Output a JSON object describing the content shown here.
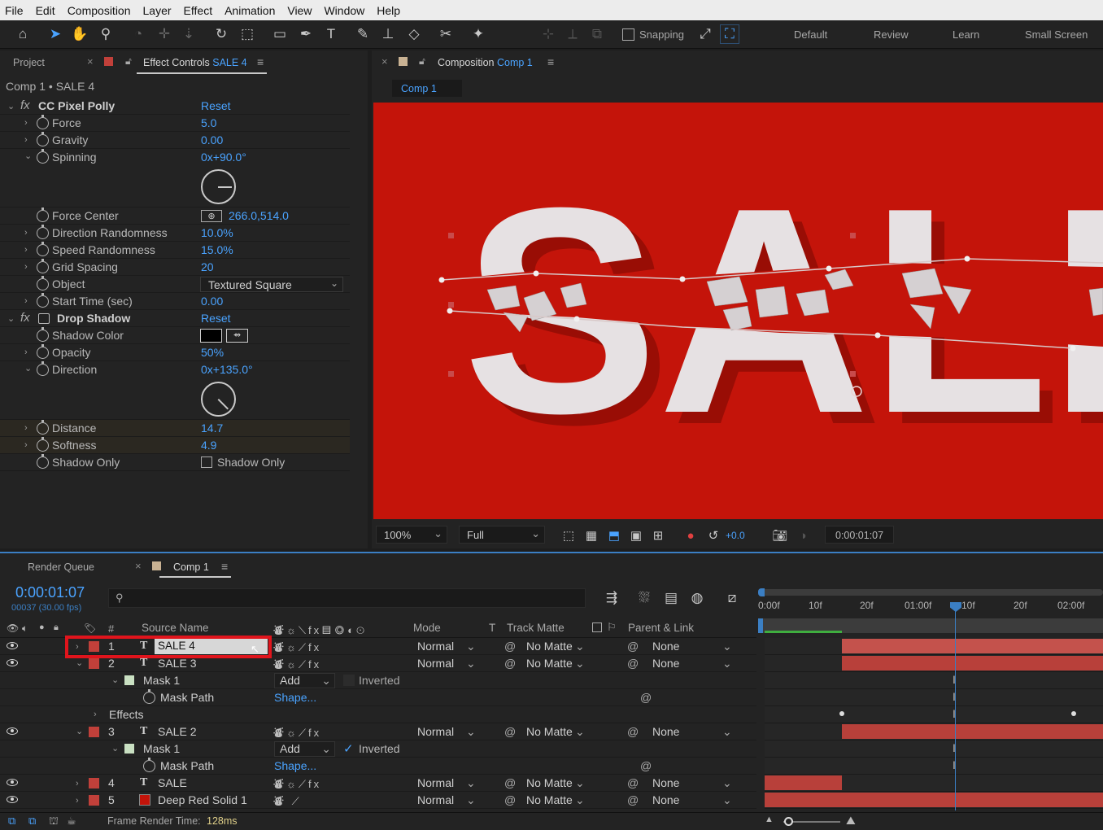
{
  "menu": [
    "File",
    "Edit",
    "Composition",
    "Layer",
    "Effect",
    "Animation",
    "View",
    "Window",
    "Help"
  ],
  "toolbar": {
    "snapping": "Snapping",
    "workspaces": [
      "Default",
      "Review",
      "Learn",
      "Small Screen"
    ]
  },
  "project_tab": "Project",
  "ec": {
    "tab_prefix": "Effect Controls",
    "tab_layer": "SALE 4",
    "context": "Comp 1 • SALE 4",
    "effects": [
      {
        "name": "CC Pixel Polly",
        "reset": "Reset"
      },
      {
        "name": "Drop Shadow",
        "reset": "Reset"
      }
    ],
    "props": [
      {
        "label": "Force",
        "value": "5.0"
      },
      {
        "label": "Gravity",
        "value": "0.00"
      },
      {
        "label": "Spinning",
        "value": "0x+90.0°"
      },
      {
        "label": "Force Center",
        "value": "266.0,514.0"
      },
      {
        "label": "Direction Randomness",
        "value": "10.0%"
      },
      {
        "label": "Speed Randomness",
        "value": "15.0%"
      },
      {
        "label": "Grid Spacing",
        "value": "20"
      },
      {
        "label": "Object",
        "value": "Textured Square"
      },
      {
        "label": "Start Time (sec)",
        "value": "0.00"
      },
      {
        "label": "Shadow Color",
        "value": ""
      },
      {
        "label": "Opacity",
        "value": "50%"
      },
      {
        "label": "Direction",
        "value": "0x+135.0°"
      },
      {
        "label": "Distance",
        "value": "14.7"
      },
      {
        "label": "Softness",
        "value": "4.9"
      },
      {
        "label": "Shadow Only",
        "value": "Shadow Only"
      }
    ]
  },
  "comp": {
    "tab_prefix": "Composition",
    "tab_name": "Comp 1",
    "flow": "Comp 1",
    "text": "SALE",
    "bg": "#c4140a",
    "zoom": "100%",
    "quality": "Full",
    "exposure": "+0.0",
    "timecode": "0:00:01:07"
  },
  "tl": {
    "render_queue": "Render Queue",
    "tab": "Comp 1",
    "time": "0:00:01:07",
    "frames": "00037 (30.00 fps)",
    "ruler": [
      "0:00f",
      "10f",
      "20f",
      "01:00f",
      "10f",
      "20f",
      "02:00f"
    ],
    "headers": {
      "num": "#",
      "source": "Source Name",
      "mode": "Mode",
      "t": "T",
      "track": "Track Matte",
      "parent": "Parent & Link"
    },
    "rows": [
      {
        "num": "1",
        "name": "SALE 4",
        "mode": "Normal",
        "matte": "No Matte",
        "parent": "None"
      },
      {
        "num": "2",
        "name": "SALE 3",
        "mode": "Normal",
        "matte": "No Matte",
        "parent": "None"
      },
      {
        "mask": "Mask 1",
        "mask_mode": "Add",
        "inverted": "Inverted",
        "path": "Mask Path",
        "shape": "Shape..."
      },
      {
        "effects": "Effects"
      },
      {
        "num": "3",
        "name": "SALE 2",
        "mode": "Normal",
        "matte": "No Matte",
        "parent": "None"
      },
      {
        "mask": "Mask 1",
        "mask_mode": "Add",
        "inverted": "Inverted",
        "path": "Mask Path",
        "shape": "Shape..."
      },
      {
        "num": "4",
        "name": "SALE",
        "mode": "Normal",
        "matte": "No Matte",
        "parent": "None"
      },
      {
        "num": "5",
        "name": "Deep Red Solid 1",
        "mode": "Normal",
        "matte": "No Matte",
        "parent": "None"
      }
    ],
    "render_time_label": "Frame Render Time:",
    "render_time": "128ms"
  },
  "colors": {
    "accent": "#4aa3ff",
    "label_red": "#c1403a",
    "bar_red": "#b8403a",
    "comp_red": "#c4140a",
    "highlight": "#e0141c"
  }
}
